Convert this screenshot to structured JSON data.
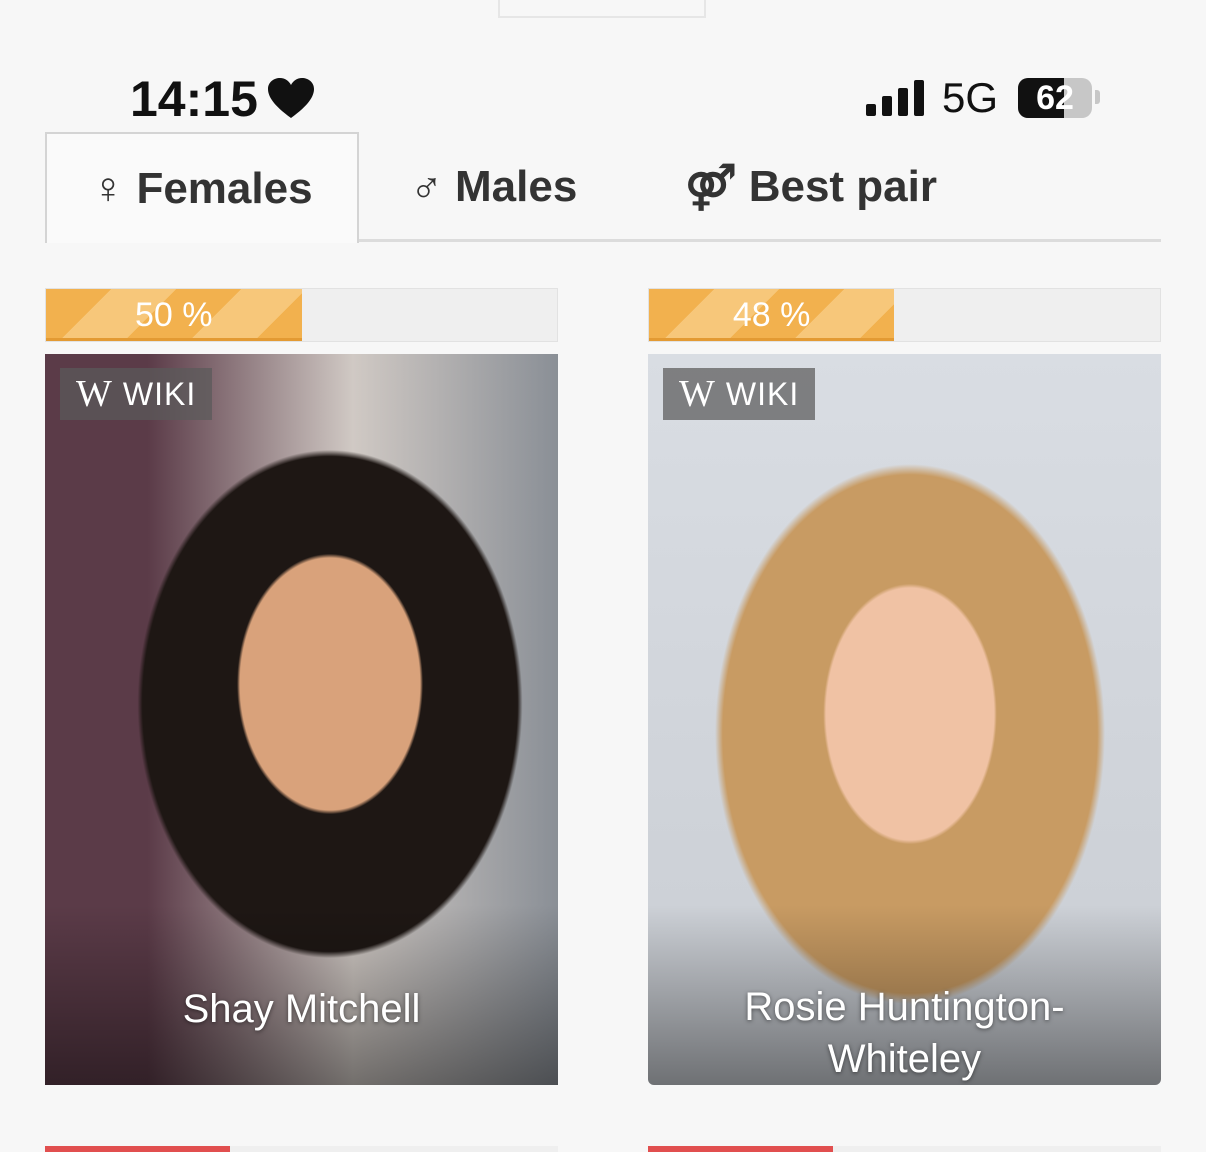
{
  "status_bar": {
    "time": "14:15",
    "network": "5G",
    "battery": "62",
    "battery_level": 0.62
  },
  "tabs": [
    {
      "symbol": "♀",
      "label": "Females",
      "active": true
    },
    {
      "symbol": "♂",
      "label": "Males",
      "active": false
    },
    {
      "symbol": "⚤",
      "label": "Best pair",
      "active": false
    }
  ],
  "cards": [
    {
      "percent": "50 %",
      "percent_value": 50,
      "wiki_label": "WIKI",
      "wiki_glyph": "W",
      "name": "Shay Mitchell"
    },
    {
      "percent": "48 %",
      "percent_value": 48,
      "wiki_label": "WIKI",
      "wiki_glyph": "W",
      "name": "Rosie Huntington-Whiteley"
    }
  ],
  "next_row_bars": [
    {
      "percent_value": 36
    },
    {
      "percent_value": 36
    }
  ],
  "colors": {
    "accent_orange": "#f2b14e",
    "next_bar_red": "#e14f4f",
    "background": "#f7f7f7"
  }
}
